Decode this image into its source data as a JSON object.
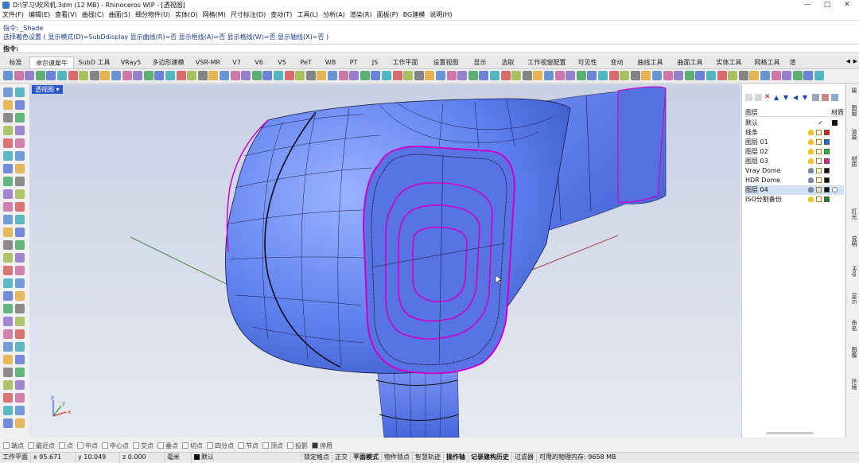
{
  "window": {
    "title": "D:\\学习\\吹风机.3dm (12 MB) - Rhinoceros WIP - [透视图]",
    "min": "—",
    "max": "□",
    "close": "✕"
  },
  "menu": [
    "文件(F)",
    "编辑(E)",
    "查看(V)",
    "曲线(C)",
    "曲面(S)",
    "细分物件(U)",
    "实体(O)",
    "网格(M)",
    "尺寸标注(D)",
    "变动(T)",
    "工具(L)",
    "分析(A)",
    "渲染(R)",
    "面板(P)",
    "BG建模",
    "说明(H)"
  ],
  "command": {
    "line1": "指令: _Shade",
    "line2": "选择着色设置 ( 显示模式(D)=SubDdisplay  显示曲线(R)=否  显示框线(A)=否  显示格线(W)=否  显示轴线(X)=否 )",
    "prompt": "指令:"
  },
  "tabs": [
    "标准",
    "卓尔谟犀牛",
    "SubD 工具",
    "VRay5",
    "多边形建模",
    "VSR-MR",
    "V7",
    "V6",
    "V5",
    "PeT",
    "WB",
    "PT",
    "JS",
    "工作平面",
    "设置视图",
    "显示",
    "选取",
    "工作视窗配置",
    "可见性",
    "变动",
    "曲线工具",
    "曲面工具",
    "实体工具",
    "网格工具",
    "渲"
  ],
  "active_tab": "卓尔谟犀牛",
  "viewport": {
    "label": "透视图",
    "dropdown": "▾",
    "axis_x": "x",
    "axis_y": "y",
    "axis_z": "z"
  },
  "layers": {
    "header_left": "图层",
    "header_right": "材质",
    "rows": [
      {
        "name": "默认",
        "check": "✓",
        "color": "#111111"
      },
      {
        "name": "线条",
        "color": "#e02020"
      },
      {
        "name": "图层 01",
        "color": "#1e6fe0"
      },
      {
        "name": "图层 02",
        "color": "#20c020"
      },
      {
        "name": "图层 03",
        "color": "#e020a0"
      },
      {
        "name": "Vray Dome",
        "color": "#111111"
      },
      {
        "name": "HDR Dome",
        "color": "#111111"
      },
      {
        "name": "图层 04",
        "color": "#111111",
        "selected": true
      },
      {
        "name": "ISO分割备份",
        "color": "#1a8c1a"
      }
    ]
  },
  "right_tabs": [
    "属",
    "图层",
    "渲染",
    "材质",
    "灯光",
    "说明",
    "Hop",
    "显示",
    "命名",
    "图像",
    "环境"
  ],
  "osnap": {
    "items": [
      "端点",
      "最近点",
      "点",
      "中点",
      "中心点",
      "交点",
      "垂点",
      "切点",
      "四分点",
      "节点",
      "顶点",
      "投影"
    ],
    "disable_label": "停用"
  },
  "status": {
    "plane": "工作平面",
    "x": "x 95.671",
    "y": "y 10.049",
    "z": "z 0.000",
    "unit": "毫米",
    "layer": "默认",
    "toggles": [
      "锁定格点",
      "正交",
      "平面模式",
      "物件锁点",
      "智慧轨迹",
      "操作轴",
      "记录建构历史",
      "过滤器"
    ],
    "memory": "可用的物理内存: 9658 MB"
  }
}
